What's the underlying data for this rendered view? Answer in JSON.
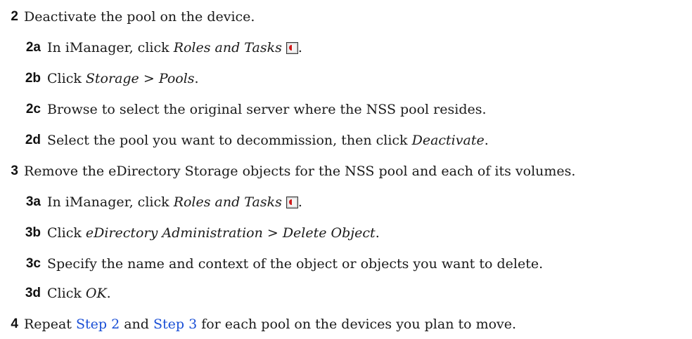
{
  "steps": [
    {
      "num": "2",
      "text": "Deactivate the pool on the device.",
      "substeps": [
        {
          "num": "2a",
          "pre": "In iManager, click ",
          "em": "Roles and Tasks",
          "icon": "roles-and-tasks-icon",
          "post": "."
        },
        {
          "num": "2b",
          "pre": "Click ",
          "em": "Storage",
          "mid": " > ",
          "em2": "Pools",
          "post": "."
        },
        {
          "num": "2c",
          "pre": "Browse to select the original server where the NSS pool resides."
        },
        {
          "num": "2d",
          "pre": "Select the pool you want to decommission, then click ",
          "em": "Deactivate",
          "post": "."
        }
      ]
    },
    {
      "num": "3",
      "text": "Remove the eDirectory Storage objects for the NSS pool and each of its volumes.",
      "substeps": [
        {
          "num": "3a",
          "pre": "In iManager, click ",
          "em": "Roles and Tasks",
          "icon": "roles-and-tasks-icon",
          "post": "."
        },
        {
          "num": "3b",
          "pre": "Click ",
          "em": "eDirectory Administration",
          "mid": " > ",
          "em2": "Delete Object",
          "post": "."
        },
        {
          "num": "3c",
          "pre": "Specify the name and context of the object or objects you want to delete."
        },
        {
          "num": "3d",
          "pre": "Click ",
          "em": "OK",
          "post": "."
        }
      ]
    },
    {
      "num": "4",
      "pre": "Repeat ",
      "link1": "Step 2",
      "mid": " and ",
      "link2": "Step 3",
      "post": " for each pool on the devices you plan to move."
    }
  ],
  "colors": {
    "link": "#1a4fd6",
    "text": "#1a1a1a"
  }
}
